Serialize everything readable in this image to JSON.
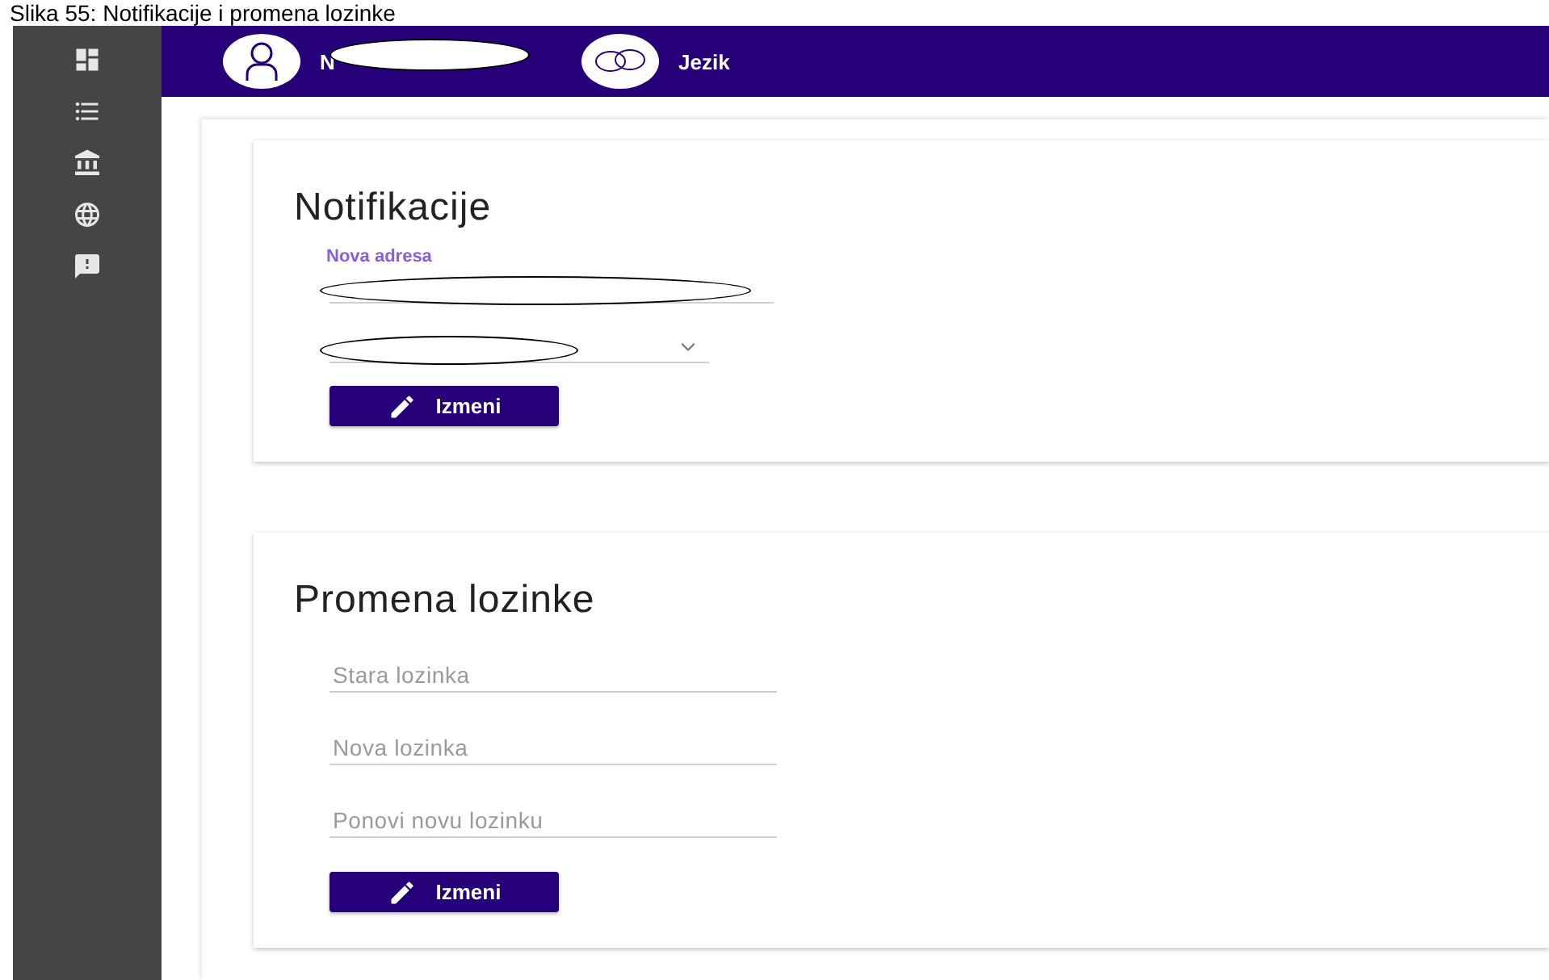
{
  "caption": "Slika 55: Notifikacije i promena lozinke",
  "sidebar": {
    "items": [
      {
        "kind": "dashboard"
      },
      {
        "kind": "list"
      },
      {
        "kind": "bank"
      },
      {
        "kind": "globe"
      },
      {
        "kind": "feedback"
      }
    ]
  },
  "header": {
    "user_name": "N",
    "language_label": "Jezik"
  },
  "notifications": {
    "title": "Notifikacije",
    "address_field": {
      "label": "Nova adresa"
    },
    "button": "Izmeni"
  },
  "password": {
    "title": "Promena lozinke",
    "fields": [
      {
        "placeholder": "Stara lozinka"
      },
      {
        "placeholder": "Nova lozinka"
      },
      {
        "placeholder": "Ponovi novu lozinku"
      }
    ],
    "button": "Izmeni"
  }
}
